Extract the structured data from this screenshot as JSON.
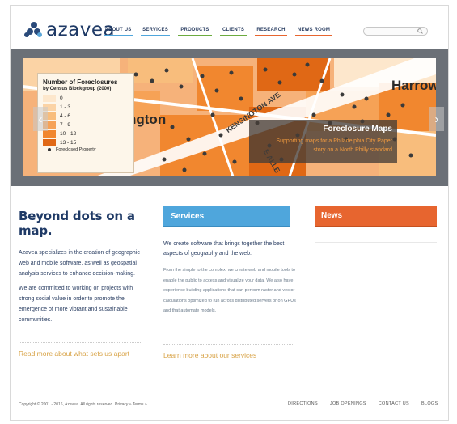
{
  "header": {
    "logo_text": "azavea",
    "nav": [
      {
        "label": "ABOUT US",
        "color": "#4fa6dc"
      },
      {
        "label": "SERVICES",
        "color": "#4fa6dc"
      },
      {
        "label": "PRODUCTS",
        "color": "#6cab3f"
      },
      {
        "label": "CLIENTS",
        "color": "#6cab3f"
      },
      {
        "label": "RESEARCH",
        "color": "#e7652f"
      },
      {
        "label": "NEWS ROOM",
        "color": "#e7652f"
      }
    ],
    "search_icon": "search-icon"
  },
  "banner": {
    "legend": {
      "title": "Number of Foreclosures",
      "subtitle": "by Census Blockgroup (2000)",
      "classes": [
        {
          "label": "0",
          "color": "#fde7cc"
        },
        {
          "label": "1 - 3",
          "color": "#fbd3a5"
        },
        {
          "label": "4 - 6",
          "color": "#f8bd7c"
        },
        {
          "label": "7 - 9",
          "color": "#f6a256"
        },
        {
          "label": "10 - 12",
          "color": "#f1872f"
        },
        {
          "label": "13 - 15",
          "color": "#e06815"
        }
      ],
      "point_label": "Foreclosed Property"
    },
    "map_labels": {
      "street1": "KENSINGTON AVE",
      "street2": "E ALLE",
      "place1": "ngton",
      "place2": "Harrowg"
    },
    "prev_icon": "chevron-left-icon",
    "next_icon": "chevron-right-icon",
    "caption": {
      "title": "Foreclosure Maps",
      "line1": "Supporting maps for a Philadelphia City Paper",
      "line2": "story on a North Philly standard"
    }
  },
  "main": {
    "headline": "Beyond dots on a map.",
    "paragraph1": "Azavea specializes in the creation of geographic web and mobile software, as well as geospatial analysis services to enhance decision-making.",
    "paragraph2": "We are committed to working on projects with strong social value in order to promote the emergence of more vibrant and sustainable communities.",
    "read_more_left": "Read more about what sets us apart",
    "services_title": "Services",
    "services_intro": "We create software that brings together the best aspects of geography and the web.",
    "services_body": "From the simple to the complex, we create web and mobile tools to enable the public to access and visualize your data. We also have experience building applications that can perform raster and vector calculations optimized to run across distributed servers or on GPUs and that automate models.",
    "read_more_mid": "Learn more about our services",
    "news_title": "News"
  },
  "footer": {
    "copyright": "Copyright © 2001 - 2016, Azavea. All rights reserved.   Privacy »   Terms »",
    "links": [
      "DIRECTIONS",
      "JOB OPENINGS",
      "CONTACT US",
      "BLOGS"
    ]
  }
}
